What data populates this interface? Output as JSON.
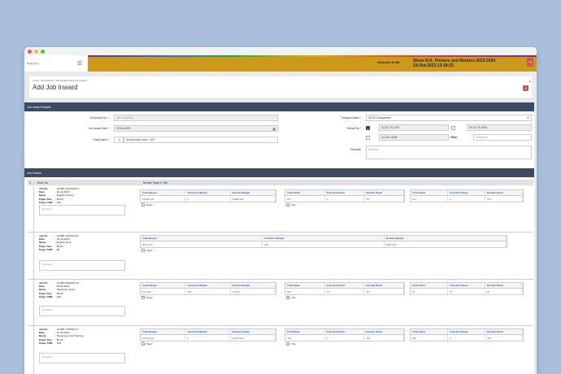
{
  "header": {
    "logo_text": "Shree R.K.",
    "menu_icon": "hamburger-icon",
    "welcome": "Welcome to RK",
    "company_line1": "Shree R.K. Printers and Binders 2023-2024",
    "company_line2": "23-Oct-2023 13:18:23",
    "logout_icon": "logout-icon"
  },
  "page": {
    "breadcrumb": "Home / Transaction / Job Inward / Add Job Inward",
    "title": "Add Job Inward",
    "close": "×"
  },
  "details": {
    "section_title": "Job Inward Details",
    "job_inward_no_label": "Job Inward No. *",
    "job_inward_no_placeholder": "Job Inward No",
    "job_inward_date_label": "Job Inward Date *",
    "job_inward_date_value": "23-Oct-2023",
    "party_name_label": "Party Name *",
    "party_name_value": "Suraj Kumar Lodhi - 129",
    "transport_name_label": "Transport Name *",
    "transport_name_value": "ASOK Transporters",
    "vehicle_no_label": "Vehicle No *",
    "vehicles": [
      "GJ-01-TD-2472",
      "GJ-01-TD-6513",
      "GJ-26-v-3636"
    ],
    "other_label": "Other",
    "vehicle_no_placeholder": "Vehicle No",
    "remarks_label": "Remarks",
    "remarks_placeholder": "Remarks"
  },
  "orders": {
    "section_title": "Job Orders",
    "col_hash": "#",
    "col_book_job": "Book Job",
    "col_remain": "Remain Paper & Title",
    "labels": {
      "job_no": "Job No",
      "date": "Date",
      "name": "Name",
      "paper_size": "Paper Size",
      "paper_gsm": "Paper GSM"
    },
    "remarks_placeholder": "Remarks",
    "weight_headers": [
      "Total Weight",
      "Transferd Weight",
      "Remain Weight"
    ],
    "ream_headers": [
      "Total Ream",
      "Transferd Ream",
      "Remain Ream"
    ],
    "sheet_headers": [
      "Total Sheet",
      "Transferd Sheet",
      "Remain Sheet"
    ],
    "paper_label": "Paper",
    "title_label": "Title",
    "rows": [
      {
        "job_no": ": rk/JBO-20/10/23-02",
        "date": ": 20-10-2023",
        "name": ": English Testing",
        "paper_size": ": 86.00",
        "paper_gsm": ": 210",
        "weight": [
          "66586.202",
          "0",
          "66586.202"
        ],
        "ream": [
          "507",
          "0",
          "507"
        ],
        "sheet": [
          "227",
          "0",
          "227"
        ]
      },
      {
        "job_no": ": rk/JBO-19/10/23-01",
        "date": ": 19-10-2023",
        "name": ": English book",
        "paper_size": ": 86.00",
        "paper_gsm": ": 80",
        "weight": [
          "5826.424",
          "433",
          "5826.424"
        ]
      },
      {
        "job_no": ": rk/JBO-09/09/23-09",
        "date": ": 09-09-2023",
        "name": ": Hardcover book",
        "paper_size": ": 86.00",
        "paper_gsm": ": 210",
        "weight": [
          "544.494",
          "952",
          "12,494"
        ],
        "ream": [
          "393",
          "43",
          "312"
        ],
        "sheet": [
          "91",
          "15",
          "86"
        ]
      },
      {
        "job_no": ": rk/JBO-27/09/23-07",
        "date": ": 27-09-2023",
        "name": ": Hardcover book Testing",
        "paper_size": ": 86.00",
        "paper_gsm": ": 210",
        "weight": [
          "34434.634",
          "0",
          "34434.634"
        ],
        "ream": [
          "494",
          "0",
          "494"
        ],
        "sheet": [
          "292",
          "0",
          "292"
        ]
      }
    ]
  }
}
